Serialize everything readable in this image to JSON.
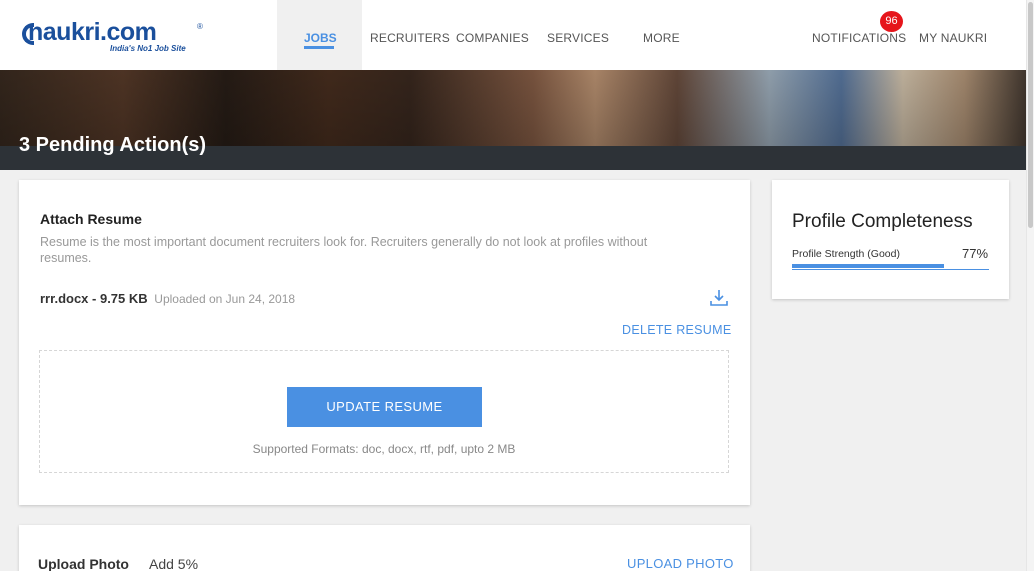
{
  "brand": {
    "name": "naukri.com",
    "tagline": "India's No1 Job Site",
    "reg": "®"
  },
  "nav": {
    "jobs": "JOBS",
    "recruiters": "RECRUITERS",
    "companies": "COMPANIES",
    "services": "SERVICES",
    "more": "MORE",
    "notifications": "NOTIFICATIONS",
    "notifications_count": "96",
    "my_naukri": "MY NAUKRI"
  },
  "banner": {
    "pending": "3 Pending Action(s)"
  },
  "resume": {
    "title": "Attach Resume",
    "description": "Resume is the most important document recruiters look for. Recruiters generally do not look at profiles without resumes.",
    "file_name": "rrr.docx - 9.75 KB",
    "uploaded": "Uploaded on Jun 24, 2018",
    "delete_label": "DELETE RESUME",
    "update_label": "UPDATE RESUME",
    "formats": "Supported Formats: doc, docx, rtf, pdf, upto 2 MB",
    "download_icon": "download-icon"
  },
  "photo": {
    "title": "Upload Photo",
    "add": "Add 5%",
    "upload_label": "UPLOAD PHOTO"
  },
  "profile": {
    "title": "Profile Completeness",
    "strength_label": "Profile Strength (Good)",
    "strength_pct": "77%",
    "strength_value": 0.77
  },
  "colors": {
    "accent": "#4a90e2",
    "brand": "#1a4f9c",
    "badge": "#e6151b"
  }
}
